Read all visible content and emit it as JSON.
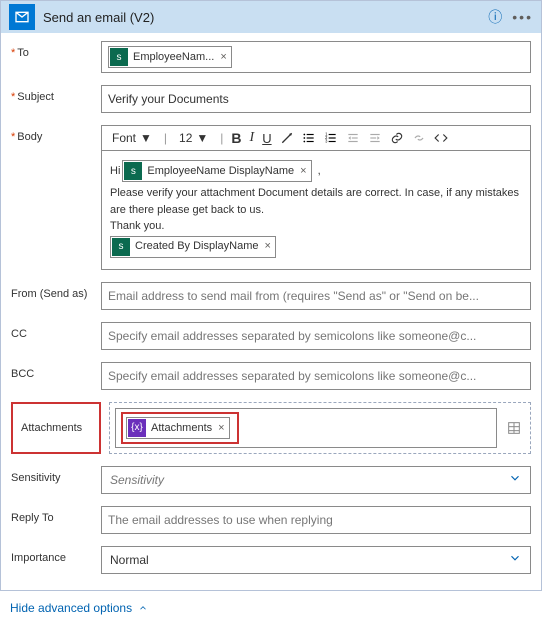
{
  "header": {
    "title": "Send an email (V2)"
  },
  "fields": {
    "to_label": "To",
    "to_token": "EmployeeNam...",
    "subject_label": "Subject",
    "subject_value": "Verify your Documents",
    "body_label": "Body",
    "font_label": "Font",
    "size_label": "12",
    "body_hi": "Hi",
    "body_token1": "EmployeeName DisplayName",
    "body_comma": ",",
    "body_line1": "Please verify your attachment Document details are correct. In case, if any mistakes are there please get back to us.",
    "body_line2": "Thank you.",
    "body_token2": "Created By DisplayName",
    "from_label": "From (Send as)",
    "from_placeholder": "Email address to send mail from (requires \"Send as\" or \"Send on be...",
    "cc_label": "CC",
    "cc_placeholder": "Specify email addresses separated by semicolons like someone@c...",
    "bcc_label": "BCC",
    "bcc_placeholder": "Specify email addresses separated by semicolons like someone@c...",
    "attach_label": "Attachments",
    "attach_token": "Attachments",
    "sensitivity_label": "Sensitivity",
    "sensitivity_placeholder": "Sensitivity",
    "reply_label": "Reply To",
    "reply_placeholder": "The email addresses to use when replying",
    "importance_label": "Importance",
    "importance_value": "Normal"
  },
  "footer": {
    "hide": "Hide advanced options"
  },
  "icons": {
    "fx": "{x}",
    "sp": "s"
  }
}
